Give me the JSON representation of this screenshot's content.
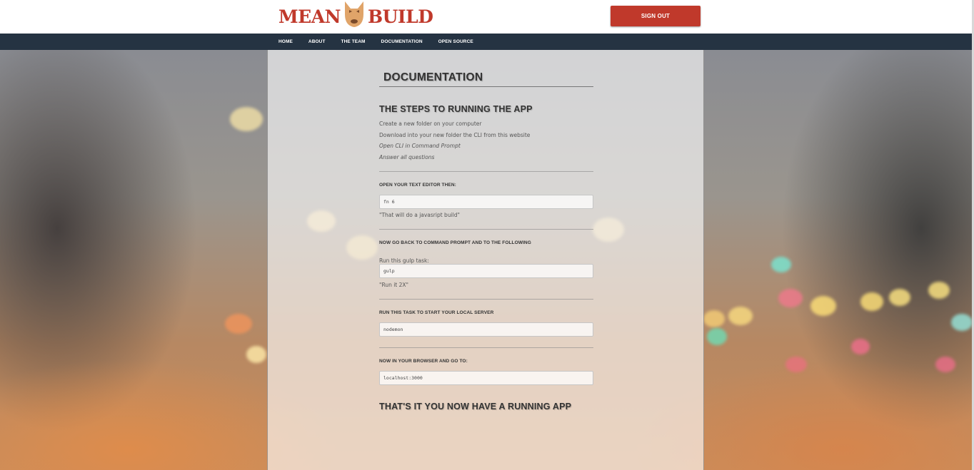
{
  "brand": {
    "logo_left": "MEAN",
    "logo_right": "BUILD"
  },
  "header": {
    "signout_label": "SIGN OUT"
  },
  "nav": {
    "items": [
      "HOME",
      "ABOUT",
      "THE TEAM",
      "DOCUMENTATION",
      "OPEN SOURCE"
    ]
  },
  "doc": {
    "title": "DOCUMENTATION",
    "steps_heading": "THE STEPS TO RUNNING THE APP",
    "steps": [
      "Create a new folder on your computer",
      "Download into your new folder the CLI from this website",
      "Open CLI in Command Prompt",
      "Answer all questions"
    ],
    "editor_heading": "OPEN YOUR TEXT EDITOR THEN:",
    "editor_code": "fn 6",
    "editor_note": "\"That will do a javasript build\"",
    "cmd_heading": "NOW GO BACK TO COMMAND PROMPT AND TO THE FOLLOWING",
    "gulp_label": "Run this gulp task:",
    "gulp_code": "gulp",
    "gulp_note": "\"Run it 2X\"",
    "server_heading": "RUN THIS TASK TO START YOUR LOCAL SERVER",
    "server_code": "nodemon",
    "browser_heading": "NOW IN YOUR BROWSER AND GO TO:",
    "browser_code": "localhost:3000",
    "final_heading": "THAT'S IT YOU NOW HAVE A RUNNING APP"
  },
  "colors": {
    "accent": "#c0392b",
    "navbar": "#253342"
  },
  "icons": {
    "logo_mascot": "dog-head-icon"
  }
}
